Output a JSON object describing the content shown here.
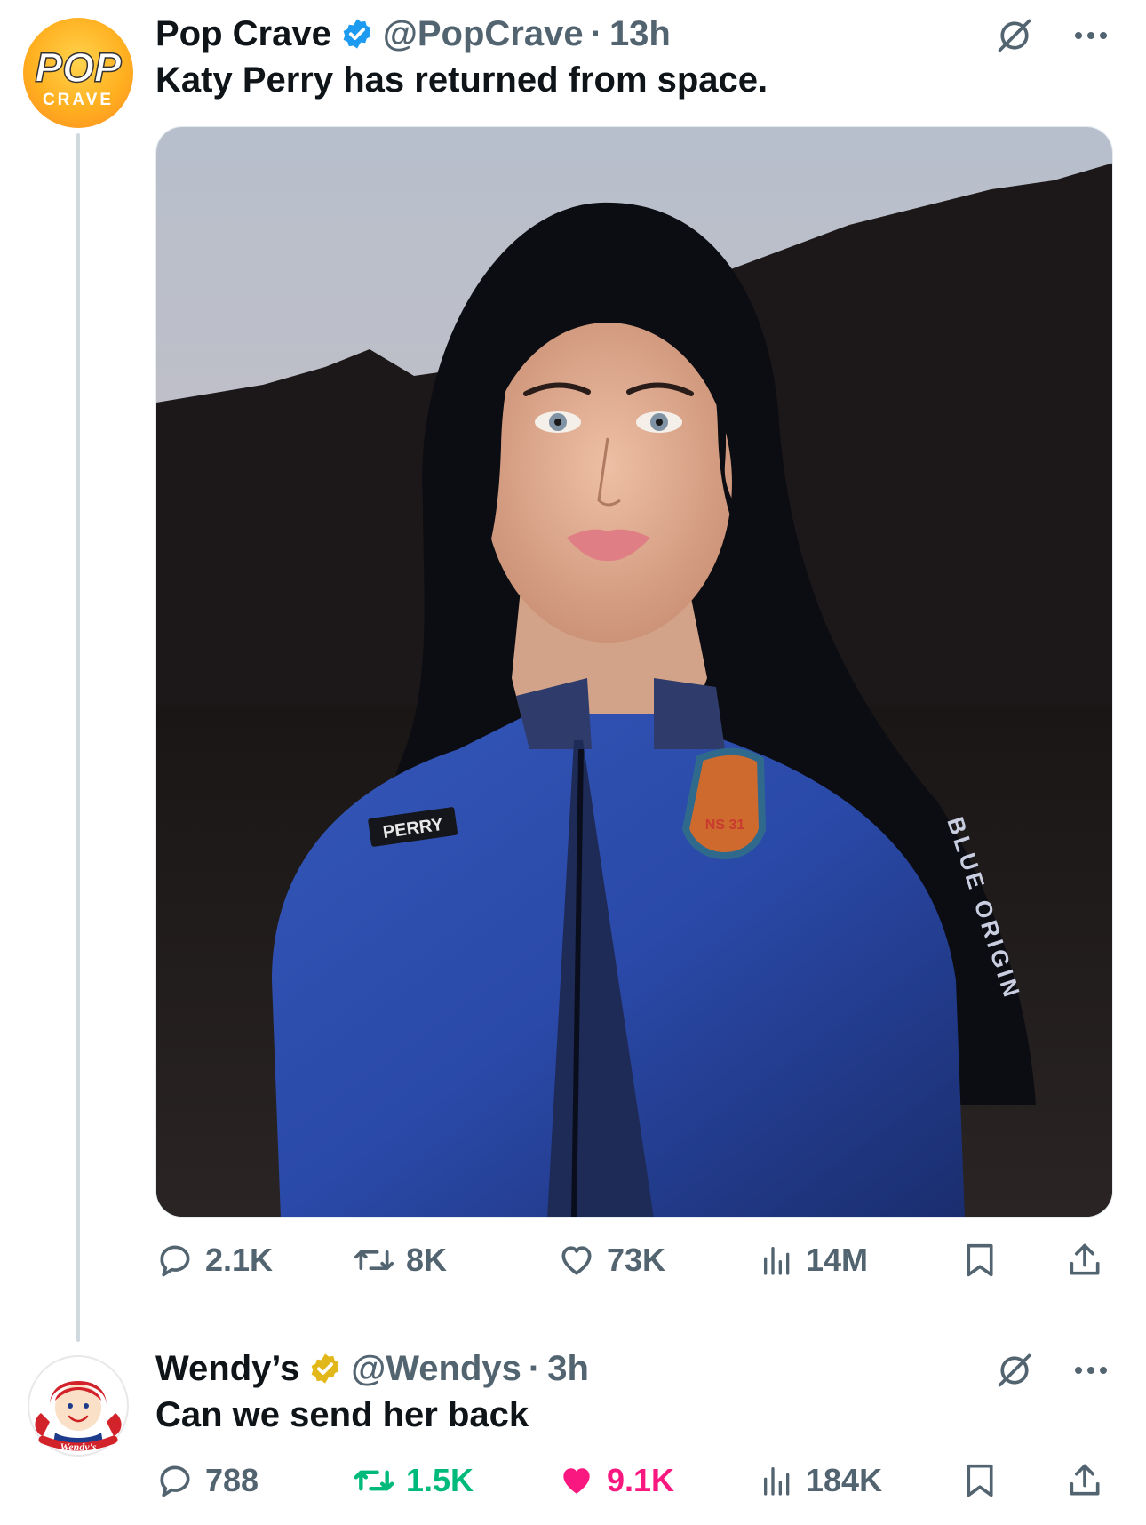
{
  "tweets": [
    {
      "author": {
        "name": "Pop Crave",
        "handle": "@PopCrave",
        "time": "13h",
        "verified": "blue"
      },
      "avatar": {
        "line1": "POP",
        "line2": "CRAVE"
      },
      "text": "Katy Perry has returned from space.",
      "media": {
        "suit_name_patch": "PERRY",
        "mission_patch": "NS 31",
        "sleeve_text": "BLUE ORIGIN"
      },
      "stats": {
        "replies": "2.1K",
        "reposts": "8K",
        "likes": "73K",
        "views": "14M"
      },
      "state": {
        "reposted": false,
        "liked": false
      }
    },
    {
      "author": {
        "name": "Wendy’s",
        "handle": "@Wendys",
        "time": "3h",
        "verified": "gold"
      },
      "avatar": {
        "label": "Wendy's"
      },
      "text": "Can we send her back",
      "stats": {
        "replies": "788",
        "reposts": "1.5K",
        "likes": "9.1K",
        "views": "184K"
      },
      "state": {
        "reposted": true,
        "liked": true
      }
    }
  ],
  "separator": "·",
  "colors": {
    "text": "#0f1419",
    "muted": "#536471",
    "blue_check": "#1d9bf0",
    "gold_check": "#e2b719",
    "repost_green": "#00ba7c",
    "like_pink": "#f91880",
    "thread_line": "#cfd9de"
  },
  "icons": [
    "grok-icon",
    "more-icon",
    "reply-icon",
    "repost-icon",
    "like-icon",
    "views-icon",
    "bookmark-icon",
    "share-icon",
    "verified-badge-icon"
  ]
}
